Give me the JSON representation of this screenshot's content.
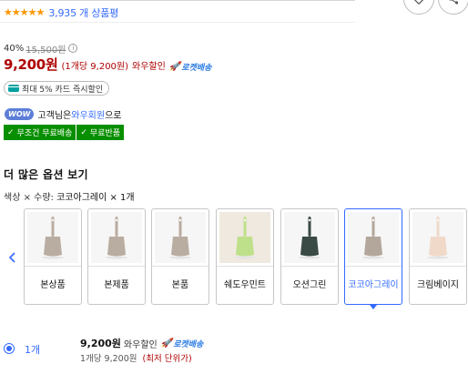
{
  "rating": {
    "stars": 5,
    "review_count": "3,935 개 상품평"
  },
  "price": {
    "discount_rate": "40%",
    "original_price": "15,500원",
    "sale_price": "9,200원",
    "unit_price": "(1개당 9,200원)",
    "wow_sale": "와우할인",
    "rocket": "로켓배송"
  },
  "card_benefit": "최대 5% 카드 즉시할인",
  "wow": {
    "badge": "WOW",
    "text_prefix": "고객님은 ",
    "member_link": "와우회원",
    "text_suffix": "으로"
  },
  "shipping_tags": [
    {
      "label": "무조건 무료배송"
    },
    {
      "label": "무료반품"
    }
  ],
  "options_section": {
    "title": "더 많은 옵션 보기",
    "summary_prefix": "색상 × 수량: ",
    "summary_value": "코코아그레이 × 1개"
  },
  "options": [
    {
      "label": "본상품",
      "color": "#b9aca0"
    },
    {
      "label": "본제품",
      "color": "#b9aca0"
    },
    {
      "label": "본품",
      "color": "#b9aca0"
    },
    {
      "label": "쉐도우민트",
      "color": "#bfe08a"
    },
    {
      "label": "오션그린",
      "color": "#3a4a44"
    },
    {
      "label": "코코아그레이",
      "color": "#b3a79b"
    },
    {
      "label": "크림베이지",
      "color": "#f0d9c8"
    }
  ],
  "selected_option": "코코아그레이",
  "quantity_option": {
    "label": "1개",
    "price": "9,200원",
    "wow_sale": "와우할인",
    "rocket": "로켓배송",
    "unit": "1개당 9,200원",
    "lowest": "(최저 단위가)"
  },
  "colors": {
    "accent": "#346aff",
    "price_red": "#ae0000",
    "star": "#ff9600",
    "ship_green": "#078f00"
  }
}
